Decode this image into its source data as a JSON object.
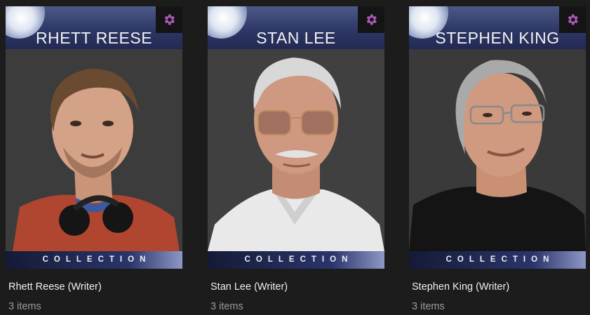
{
  "cards": [
    {
      "poster_name": "RHETT REESE",
      "collection_label": "COLLECTION",
      "title": "Rhett Reese (Writer)",
      "count": "3 items",
      "gear_icon": "gear-icon"
    },
    {
      "poster_name": "STAN LEE",
      "collection_label": "COLLECTION",
      "title": "Stan Lee (Writer)",
      "count": "3 items",
      "gear_icon": "gear-icon"
    },
    {
      "poster_name": "STEPHEN KING",
      "collection_label": "COLLECTION",
      "title": "Stephen King (Writer)",
      "count": "3 items",
      "gear_icon": "gear-icon"
    }
  ],
  "colors": {
    "page_background": "#1c1c1c",
    "gear_accent": "#a85ab4",
    "header_blue": "#2e3866"
  }
}
